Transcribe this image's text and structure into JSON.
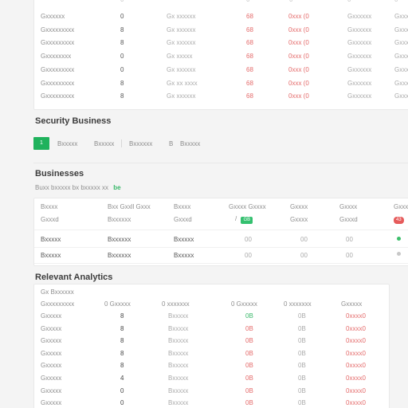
{
  "top_table": {
    "rows": [
      {
        "name": "Gxxxxxx",
        "num": "0",
        "desc": "Gx xxxxxx",
        "a": "68",
        "b": "0xxx (0",
        "c": "Gxxxxxx",
        "d": "Gxxxx"
      },
      {
        "name": "Gxxxxxxxxx",
        "num": "8",
        "desc": "Gx xxxxxx",
        "a": "68",
        "b": "0xxx (0",
        "c": "Gxxxxxx",
        "d": "Gxxxx"
      },
      {
        "name": "Gxxxxxxxxx",
        "num": "8",
        "desc": "Gx xxxxxx",
        "a": "68",
        "b": "0xxx (0",
        "c": "Gxxxxxx",
        "d": "Gxxxx"
      },
      {
        "name": "Gxxxxxxxx",
        "num": "0",
        "desc": "Gx xxxxx",
        "a": "68",
        "b": "0xxx (0",
        "c": "Gxxxxxx",
        "d": "Gxxxx"
      },
      {
        "name": "Gxxxxxxxxx",
        "num": "0",
        "desc": "Gx xxxxxx",
        "a": "68",
        "b": "0xxx (0",
        "c": "Gxxxxxx",
        "d": "Gxxxx"
      },
      {
        "name": "Gxxxxxxxxx",
        "num": "8",
        "desc": "Gx xx xxxx",
        "a": "68",
        "b": "0xxx (0",
        "c": "Gxxxxxx",
        "d": "Gxxxx"
      },
      {
        "name": "Gxxxxxxxxx",
        "num": "8",
        "desc": "Gx xxxxxx",
        "a": "68",
        "b": "0xxx (0",
        "c": "Gxxxxxx",
        "d": "Gxxxx"
      }
    ]
  },
  "security_section": {
    "title": "Security Business",
    "filter_active": "1",
    "filters": [
      "Bxxxxx",
      "Bxxxxx",
      "Bxxxxxx",
      "Bxxxxx"
    ],
    "filter_icon_text": "B"
  },
  "businesses_section": {
    "title": "Businesses",
    "subtitle": "Buxx bxxxxx bx bxxxxx xx",
    "subtitle_badge": "be",
    "table": {
      "headers": [
        "Bxxxx",
        "Bxx Gxxll Gxxx",
        "Bxxxx",
        "Gxxxx Gxxxx",
        "Gxxxx",
        "Gxxxx",
        "Gxxx"
      ],
      "highlight_row": {
        "c1": "Gxxxd",
        "c2": "Bxxxxxx",
        "c3": "Gxxxd",
        "c4_prefix": "/",
        "c4_badge": "GB",
        "c5": "Gxxxx",
        "c6": "Gxxxd",
        "c7_badge": "43"
      },
      "rows": [
        {
          "c1": "Bxxxxx",
          "c2": "Bxxxxxx",
          "c3": "Bxxxxx",
          "c4": "00",
          "c5": "00",
          "c6": "00"
        },
        {
          "c1": "Bxxxxx",
          "c2": "Bxxxxxx",
          "c3": "Bxxxxx",
          "c4": "00",
          "c5": "00",
          "c6": "00"
        }
      ]
    }
  },
  "relevant_section": {
    "title": "Relevant Analytics",
    "table_label": "Gx Bxxxxxx",
    "headers": [
      "Gxxxxxxxxx",
      "0 Gxxxxx",
      "0 xxxxxxx",
      "0 Gxxxxx",
      "0 xxxxxxx",
      "Gxxxxx"
    ],
    "rows": [
      {
        "name": "Gxxxxx",
        "num": "8",
        "desc": "Bxxxxx",
        "a": "0B",
        "b": "0B",
        "c": "0xxxx0"
      },
      {
        "name": "Gxxxxx",
        "num": "8",
        "desc": "Bxxxxx",
        "a": "0B",
        "b": "0B",
        "c": "0xxxx0"
      },
      {
        "name": "Gxxxxx",
        "num": "8",
        "desc": "Bxxxxx",
        "a": "0B",
        "b": "0B",
        "c": "0xxxx0"
      },
      {
        "name": "Gxxxxx",
        "num": "8",
        "desc": "Bxxxxx",
        "a": "0B",
        "b": "0B",
        "c": "0xxxx0"
      },
      {
        "name": "Gxxxxx",
        "num": "8",
        "desc": "Bxxxxx",
        "a": "0B",
        "b": "0B",
        "c": "0xxxx0"
      },
      {
        "name": "Gxxxxx",
        "num": "4",
        "desc": "Bxxxxx",
        "a": "0B",
        "b": "0B",
        "c": "0xxxx0"
      },
      {
        "name": "Gxxxxx",
        "num": "0",
        "desc": "Bxxxxx",
        "a": "0B",
        "b": "0B",
        "c": "0xxxx0"
      },
      {
        "name": "Gxxxxx",
        "num": "0",
        "desc": "Bxxxxx",
        "a": "0B",
        "b": "0B",
        "c": "0xxxx0"
      }
    ]
  },
  "colors": {
    "accent_green": "#1fb25c",
    "negative_red": "#e46a6a",
    "background": "#f4f4f4"
  }
}
